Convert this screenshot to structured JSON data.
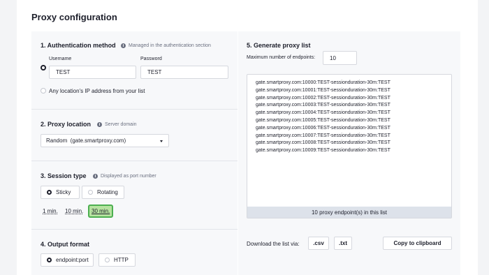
{
  "page": {
    "title": "Proxy configuration"
  },
  "auth": {
    "title": "1. Authentication method",
    "hint": "Managed in the authentication section",
    "username_label": "Username",
    "username_value": "TEST",
    "password_label": "Password",
    "password_value": "TEST",
    "ip_option": "Any location's IP address from your list"
  },
  "location": {
    "title": "2. Proxy location",
    "hint": "Server domain",
    "selected": "Random  (gate.smartproxy.com)"
  },
  "session": {
    "title": "3. Session type",
    "hint": "Displayed as port number",
    "sticky": "Sticky",
    "rotating": "Rotating",
    "durations": [
      "1 min.",
      "10 min.",
      "30 min."
    ],
    "active_duration": "30 min."
  },
  "output": {
    "title": "4. Output format",
    "endpoint_port": "endpoint:port",
    "http": "HTTP"
  },
  "generate": {
    "title": "5. Generate proxy list",
    "max_label": "Maximum number of endpoints:",
    "max_value": "10",
    "endpoints": [
      "gate.smartproxy.com:10000:TEST-sessionduration-30m:TEST",
      "gate.smartproxy.com:10001:TEST-sessionduration-30m:TEST",
      "gate.smartproxy.com:10002:TEST-sessionduration-30m:TEST",
      "gate.smartproxy.com:10003:TEST-sessionduration-30m:TEST",
      "gate.smartproxy.com:10004:TEST-sessionduration-30m:TEST",
      "gate.smartproxy.com:10005:TEST-sessionduration-30m:TEST",
      "gate.smartproxy.com:10006:TEST-sessionduration-30m:TEST",
      "gate.smartproxy.com:10007:TEST-sessionduration-30m:TEST",
      "gate.smartproxy.com:10008:TEST-sessionduration-30m:TEST",
      "gate.smartproxy.com:10009:TEST-sessionduration-30m:TEST"
    ],
    "count_text": "10 proxy endpoint(s) in this list",
    "download_label": "Download the list via:",
    "csv": ".csv",
    "txt": ".txt",
    "copy": "Copy to clipboard"
  },
  "colors": {
    "active_green_bg": "#b6e3a0",
    "active_green_border": "#4caf50",
    "panel_bg": "#f7f8fa"
  }
}
